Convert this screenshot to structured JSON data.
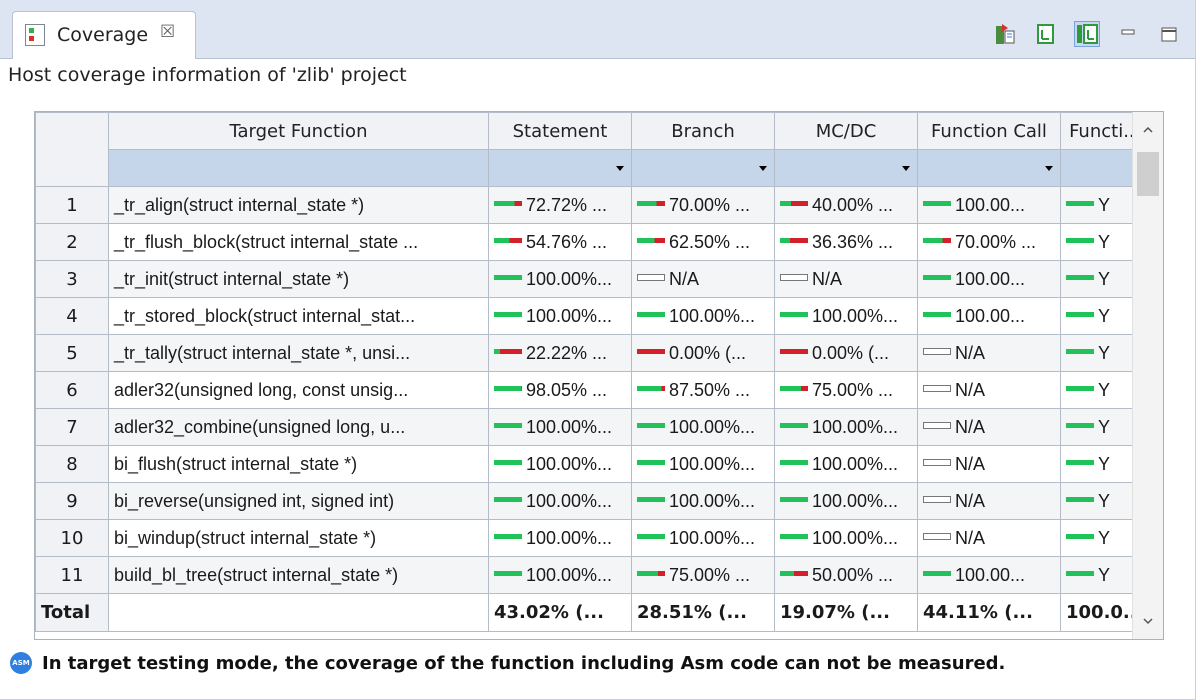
{
  "tab": {
    "title": "Coverage",
    "close_glyph": "☒"
  },
  "toolbar": {
    "buttons": [
      "export-icon",
      "collapse-icon",
      "layout-icon",
      "minimize-icon",
      "maximize-icon"
    ]
  },
  "subtitle": "Host coverage information of 'zlib' project",
  "table": {
    "columns": [
      "Target Function",
      "Statement",
      "Branch",
      "MC/DC",
      "Function Call",
      "Functi..."
    ],
    "rows": [
      {
        "num": "1",
        "fn": "_tr_align(struct internal_state *)",
        "cells": [
          "72.72% ...",
          "70.00% ...",
          "40.00% ...",
          "100.00...",
          "Y"
        ]
      },
      {
        "num": "2",
        "fn": "_tr_flush_block(struct internal_state ...",
        "cells": [
          "54.76% ...",
          "62.50% ...",
          "36.36% ...",
          "70.00% ...",
          "Y"
        ]
      },
      {
        "num": "3",
        "fn": "_tr_init(struct internal_state *)",
        "cells": [
          "100.00%...",
          "N/A",
          "N/A",
          "100.00...",
          "Y"
        ]
      },
      {
        "num": "4",
        "fn": "_tr_stored_block(struct internal_stat...",
        "cells": [
          "100.00%...",
          "100.00%...",
          "100.00%...",
          "100.00...",
          "Y"
        ]
      },
      {
        "num": "5",
        "fn": "_tr_tally(struct internal_state *, unsi...",
        "cells": [
          "22.22% ...",
          "0.00% (...",
          "0.00% (...",
          "N/A",
          "Y"
        ]
      },
      {
        "num": "6",
        "fn": "adler32(unsigned long, const unsig...",
        "cells": [
          "98.05% ...",
          "87.50% ...",
          "75.00% ...",
          "N/A",
          "Y"
        ]
      },
      {
        "num": "7",
        "fn": "adler32_combine(unsigned long, u...",
        "cells": [
          "100.00%...",
          "100.00%...",
          "100.00%...",
          "N/A",
          "Y"
        ]
      },
      {
        "num": "8",
        "fn": "bi_flush(struct internal_state *)",
        "cells": [
          "100.00%...",
          "100.00%...",
          "100.00%...",
          "N/A",
          "Y"
        ]
      },
      {
        "num": "9",
        "fn": "bi_reverse(unsigned int, signed int)",
        "cells": [
          "100.00%...",
          "100.00%...",
          "100.00%...",
          "N/A",
          "Y"
        ]
      },
      {
        "num": "10",
        "fn": "bi_windup(struct internal_state *)",
        "cells": [
          "100.00%...",
          "100.00%...",
          "100.00%...",
          "N/A",
          "Y"
        ]
      },
      {
        "num": "11",
        "fn": "build_bl_tree(struct internal_state *)",
        "cells": [
          "100.00%...",
          "75.00% ...",
          "50.00% ...",
          "100.00...",
          "Y"
        ]
      }
    ],
    "coverage_fractions": [
      [
        0.7272,
        0.7,
        0.4,
        1.0,
        1.0
      ],
      [
        0.5476,
        0.625,
        0.3636,
        0.7,
        1.0
      ],
      [
        1.0,
        null,
        null,
        1.0,
        1.0
      ],
      [
        1.0,
        1.0,
        1.0,
        1.0,
        1.0
      ],
      [
        0.2222,
        0.0,
        0.0,
        null,
        1.0
      ],
      [
        0.9805,
        0.875,
        0.75,
        null,
        1.0
      ],
      [
        1.0,
        1.0,
        1.0,
        null,
        1.0
      ],
      [
        1.0,
        1.0,
        1.0,
        null,
        1.0
      ],
      [
        1.0,
        1.0,
        1.0,
        null,
        1.0
      ],
      [
        1.0,
        1.0,
        1.0,
        null,
        1.0
      ],
      [
        1.0,
        0.75,
        0.5,
        1.0,
        1.0
      ]
    ],
    "total": {
      "label": "Total",
      "cells": [
        "43.02% (...",
        "28.51% (...",
        "19.07% (...",
        "44.11% (...",
        "100.0..."
      ]
    }
  },
  "note": {
    "badge": "ASM",
    "text": "In target testing mode, the coverage of the function including Asm code can not be measured."
  },
  "colors": {
    "covered": "#22c25a",
    "uncovered": "#d3202a",
    "header_bg": "#dce5f1",
    "filter_bg": "#c5d5ea"
  }
}
